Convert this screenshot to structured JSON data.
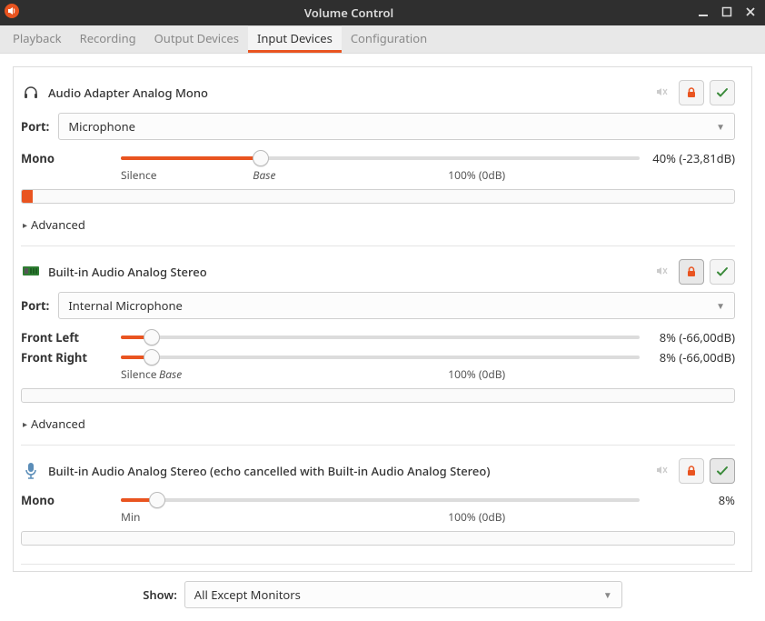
{
  "title": "Volume Control",
  "tabs": [
    "Playback",
    "Recording",
    "Output Devices",
    "Input Devices",
    "Configuration"
  ],
  "active_tab": 3,
  "port_label": "Port:",
  "advanced_label": "Advanced",
  "show_label": "Show:",
  "show_value": "All Except Monitors",
  "scale": {
    "silence": "Silence",
    "min": "Min",
    "base": "Base",
    "full": "100% (0dB)"
  },
  "devices": [
    {
      "icon": "headphones",
      "name": "Audio Adapter Analog Mono",
      "port": "Microphone",
      "locked": true,
      "fallback": true,
      "fallback_active": false,
      "channels": [
        {
          "label": "Mono",
          "percent": 40,
          "text": "40% (-23,81dB)",
          "thumb_pct": 27
        }
      ],
      "scale_has_silence_base": true,
      "level_pct": 1.5,
      "advanced": true
    },
    {
      "icon": "card",
      "name": "Built-in Audio Analog Stereo",
      "port": "Internal Microphone",
      "locked": true,
      "locked_active": true,
      "fallback": true,
      "fallback_active": false,
      "channels": [
        {
          "label": "Front Left",
          "percent": 8,
          "text": "8% (-66,00dB)",
          "thumb_pct": 6
        },
        {
          "label": "Front Right",
          "percent": 8,
          "text": "8% (-66,00dB)",
          "thumb_pct": 6
        }
      ],
      "scale_has_silence_base": true,
      "scale_compact_base": true,
      "level_pct": 0,
      "advanced": true
    },
    {
      "icon": "mic",
      "name": "Built-in Audio Analog Stereo (echo cancelled with Built-in Audio Analog Stereo)",
      "locked": true,
      "fallback": true,
      "fallback_active": true,
      "channels": [
        {
          "label": "Mono",
          "percent": 8,
          "text": "8%",
          "thumb_pct": 7
        }
      ],
      "scale_has_min": true,
      "level_pct": 0,
      "advanced": false
    }
  ]
}
